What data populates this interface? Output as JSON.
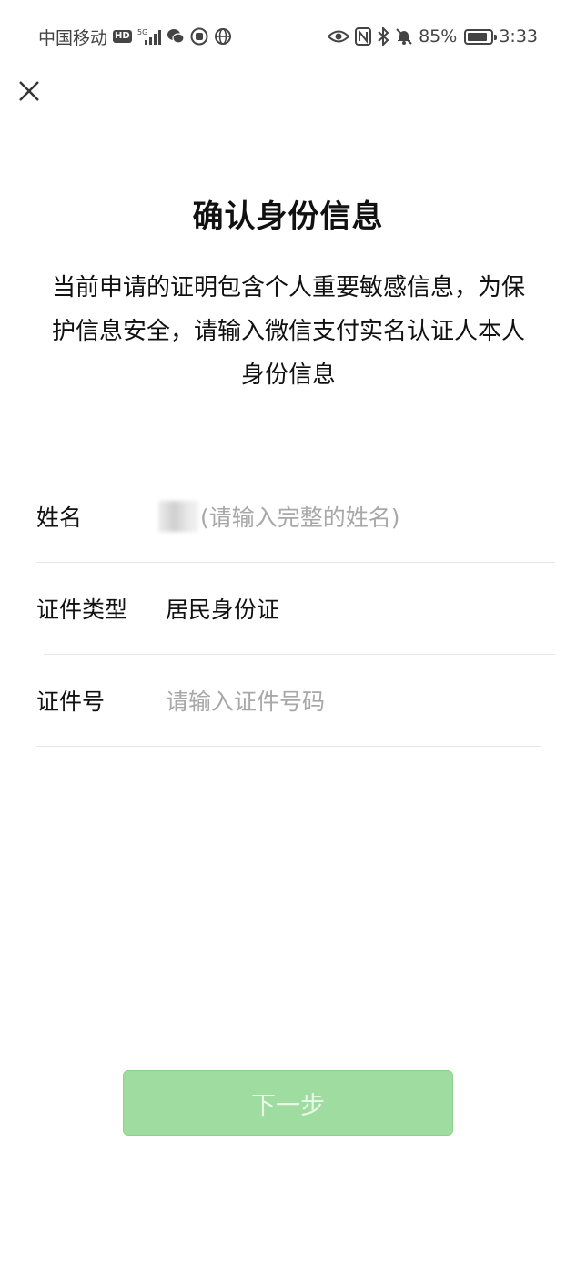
{
  "status_bar": {
    "carrier": "中国移动",
    "hd": "HD",
    "network": "5G",
    "battery": "85%",
    "battery_level": 0.85,
    "time": "3:33"
  },
  "page": {
    "title": "确认身份信息",
    "description": "当前申请的证明包含个人重要敏感信息，为保护信息安全，请输入微信支付实名认证人本人身份信息"
  },
  "form": {
    "name": {
      "label": "姓名",
      "placeholder": "(请输入完整的姓名)"
    },
    "id_type": {
      "label": "证件类型",
      "value": "居民身份证"
    },
    "id_number": {
      "label": "证件号",
      "placeholder": "请输入证件号码"
    }
  },
  "actions": {
    "next_label": "下一步"
  },
  "colors": {
    "button_bg": "#9fdc9f",
    "button_text": "#e9f8e9",
    "placeholder": "#a8a8a8"
  }
}
